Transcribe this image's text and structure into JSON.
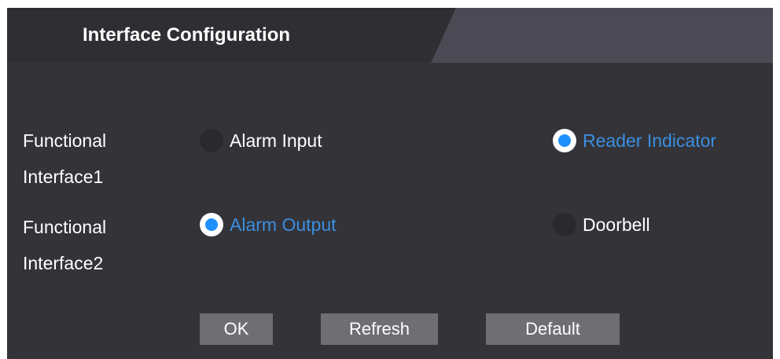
{
  "header": {
    "title": "Interface Configuration"
  },
  "rows": [
    {
      "label_line1": "Functional",
      "label_line2": "Interface1",
      "options": [
        {
          "label": "Alarm Input",
          "selected": false
        },
        {
          "label": "Reader Indicator",
          "selected": true
        }
      ]
    },
    {
      "label_line1": "Functional",
      "label_line2": "Interface2",
      "options": [
        {
          "label": "Alarm Output",
          "selected": true
        },
        {
          "label": "Doorbell",
          "selected": false
        }
      ]
    }
  ],
  "buttons": {
    "ok": "OK",
    "refresh": "Refresh",
    "default": "Default"
  },
  "colors": {
    "panel": "#333338",
    "selected_text": "#3b8fe0",
    "radio_dot": "#1e90ff",
    "button": "#6e6e73"
  }
}
